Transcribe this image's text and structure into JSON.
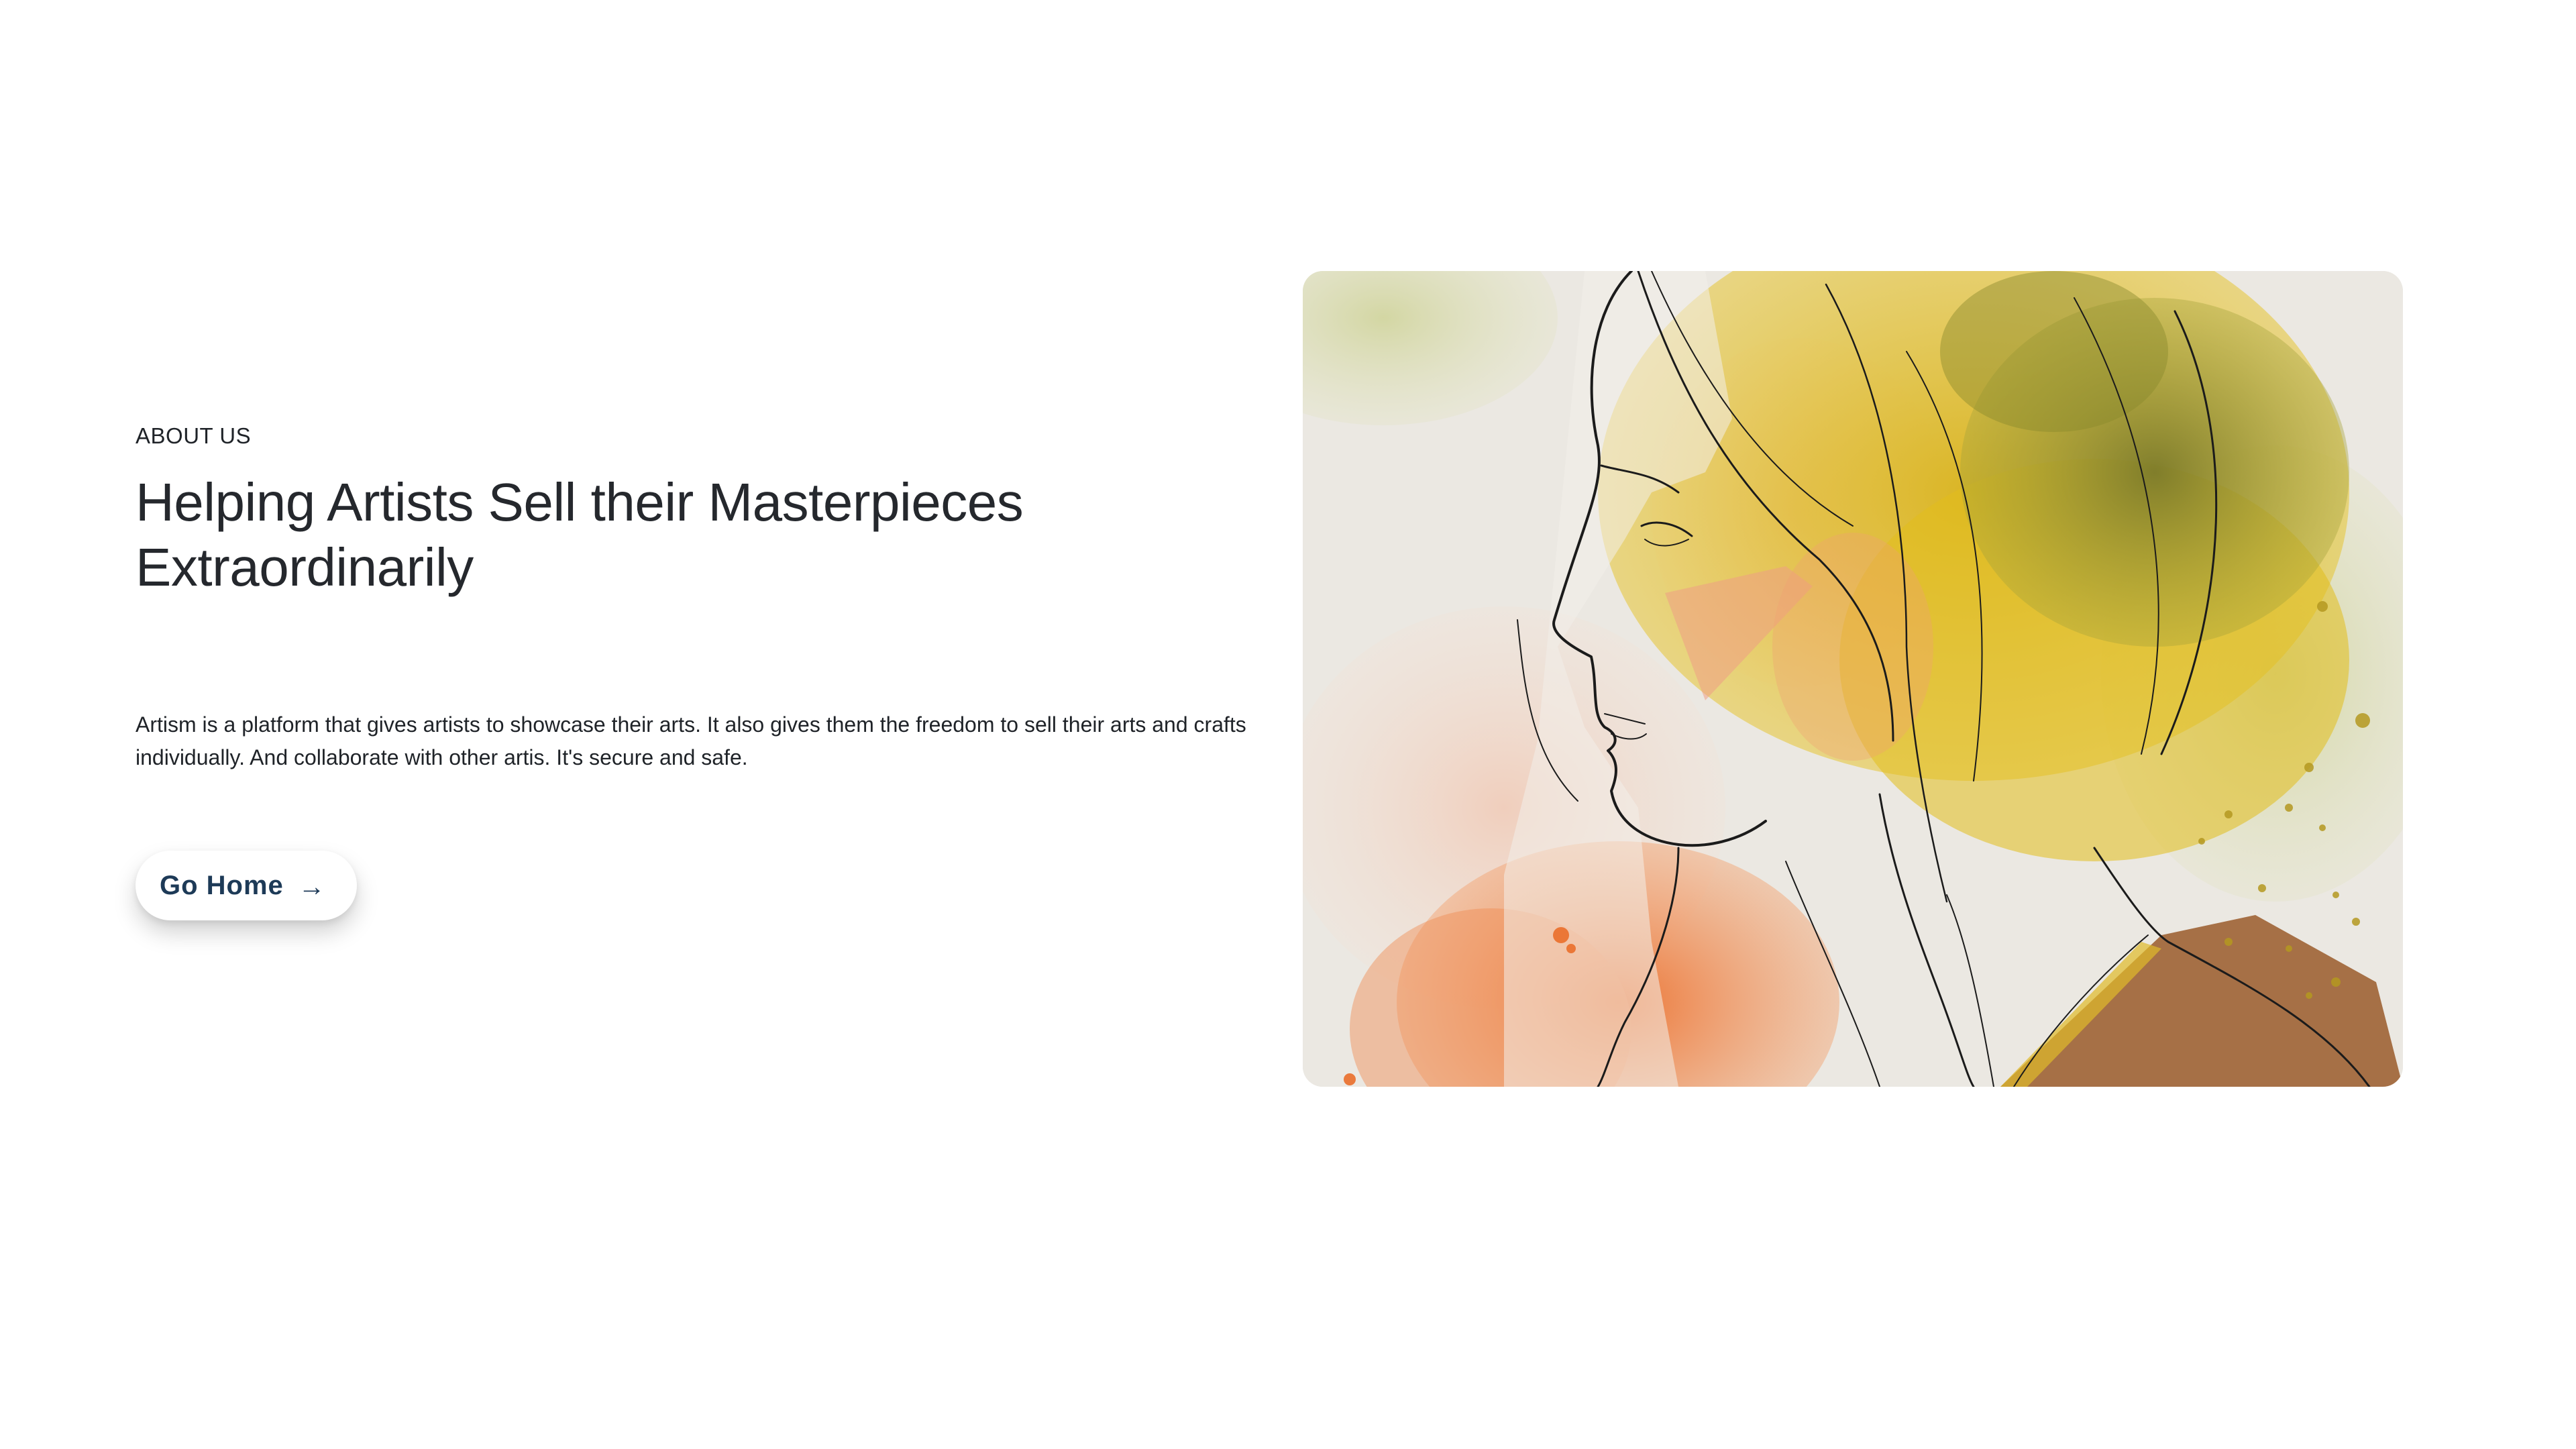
{
  "about": {
    "eyebrow": "ABOUT US",
    "headline": "Helping Artists Sell their Masterpieces Extraordinarily",
    "description": "Artism is a platform that gives artists to showcase their arts. It also gives them the freedom to sell their arts and crafts individually. And collaborate with other artis. It's secure and safe.",
    "button": {
      "label": "Go Home",
      "icon": "arrow-right-icon"
    }
  },
  "artwork": {
    "icon": "watercolor-portrait-illustration",
    "colors": {
      "paper": "#ece9e3",
      "yellow": "#e2bd1c",
      "olive": "#8f8a2e",
      "orange": "#ee7a3a",
      "peach": "#f1b9a2",
      "brown": "#9a5a2a",
      "line": "#1b1b1b"
    }
  },
  "theme": {
    "button_text": "#1d3a57",
    "heading_text": "#25282d"
  }
}
